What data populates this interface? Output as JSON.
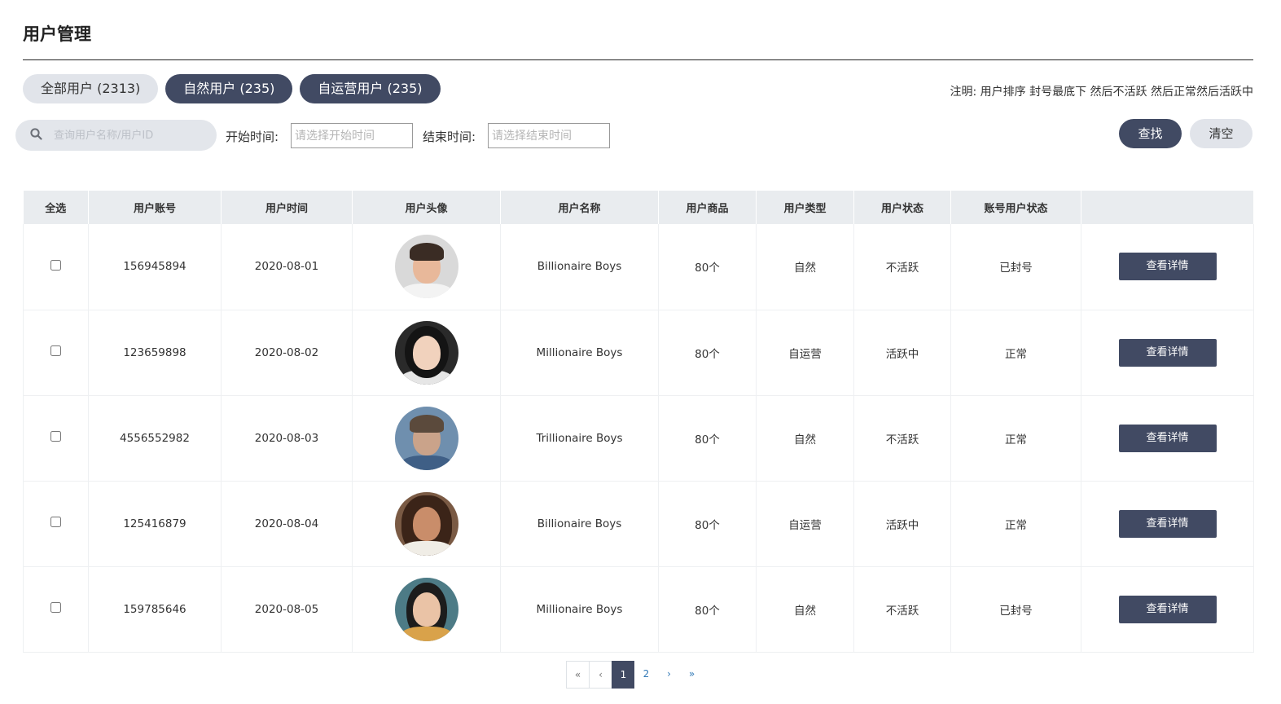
{
  "page": {
    "title": "用户管理"
  },
  "filter_tabs": [
    {
      "label": "全部用户 (2313)",
      "active": false
    },
    {
      "label": "自然用户 (235)",
      "active": true
    },
    {
      "label": "自运营用户 (235)",
      "active": true
    }
  ],
  "note": "注明: 用户排序 封号最底下 然后不活跃 然后正常然后活跃中",
  "search": {
    "placeholder": "查询用户名称/用户ID",
    "value": ""
  },
  "date_filter": {
    "start_label": "开始时间:",
    "start_placeholder": "请选择开始时间",
    "end_label": "结束时间:",
    "end_placeholder": "请选择结束时间"
  },
  "actions": {
    "search_label": "查找",
    "clear_label": "清空"
  },
  "table": {
    "headers": [
      "全选",
      "用户账号",
      "用户时间",
      "用户头像",
      "用户名称",
      "用户商品",
      "用户类型",
      "用户状态",
      "账号用户状态",
      ""
    ],
    "detail_label": "查看详情",
    "rows": [
      {
        "account": "156945894",
        "date": "2020-08-01",
        "avatar": "avatar-man-short-dark-hair",
        "name": "Billionaire Boys",
        "goods": "80个",
        "type": "自然",
        "status": "不活跃",
        "account_status": "已封号"
      },
      {
        "account": "123659898",
        "date": "2020-08-02",
        "avatar": "avatar-woman-dark-hair",
        "name": "Millionaire Boys",
        "goods": "80个",
        "type": "自运营",
        "status": "活跃中",
        "account_status": "正常"
      },
      {
        "account": "4556552982",
        "date": "2020-08-03",
        "avatar": "avatar-man-bearded-denim",
        "name": "Trillionaire Boys",
        "goods": "80个",
        "type": "自然",
        "status": "不活跃",
        "account_status": "正常"
      },
      {
        "account": "125416879",
        "date": "2020-08-04",
        "avatar": "avatar-man-dreadlocks",
        "name": "Billionaire Boys",
        "goods": "80个",
        "type": "自运营",
        "status": "活跃中",
        "account_status": "正常"
      },
      {
        "account": "159785646",
        "date": "2020-08-05",
        "avatar": "avatar-woman-long-hair",
        "name": "Millionaire Boys",
        "goods": "80个",
        "type": "自然",
        "status": "不活跃",
        "account_status": "已封号"
      }
    ]
  },
  "pagination": {
    "first": "«",
    "prev": "‹",
    "pages": [
      "1",
      "2"
    ],
    "current": "1",
    "next": "›",
    "last": "»"
  },
  "colors": {
    "primary": "#414a63",
    "inactive_pill": "#e1e4ea",
    "status_red": "#e0171d",
    "status_green": "#1f8f23",
    "header_bg": "#e9ecef"
  }
}
